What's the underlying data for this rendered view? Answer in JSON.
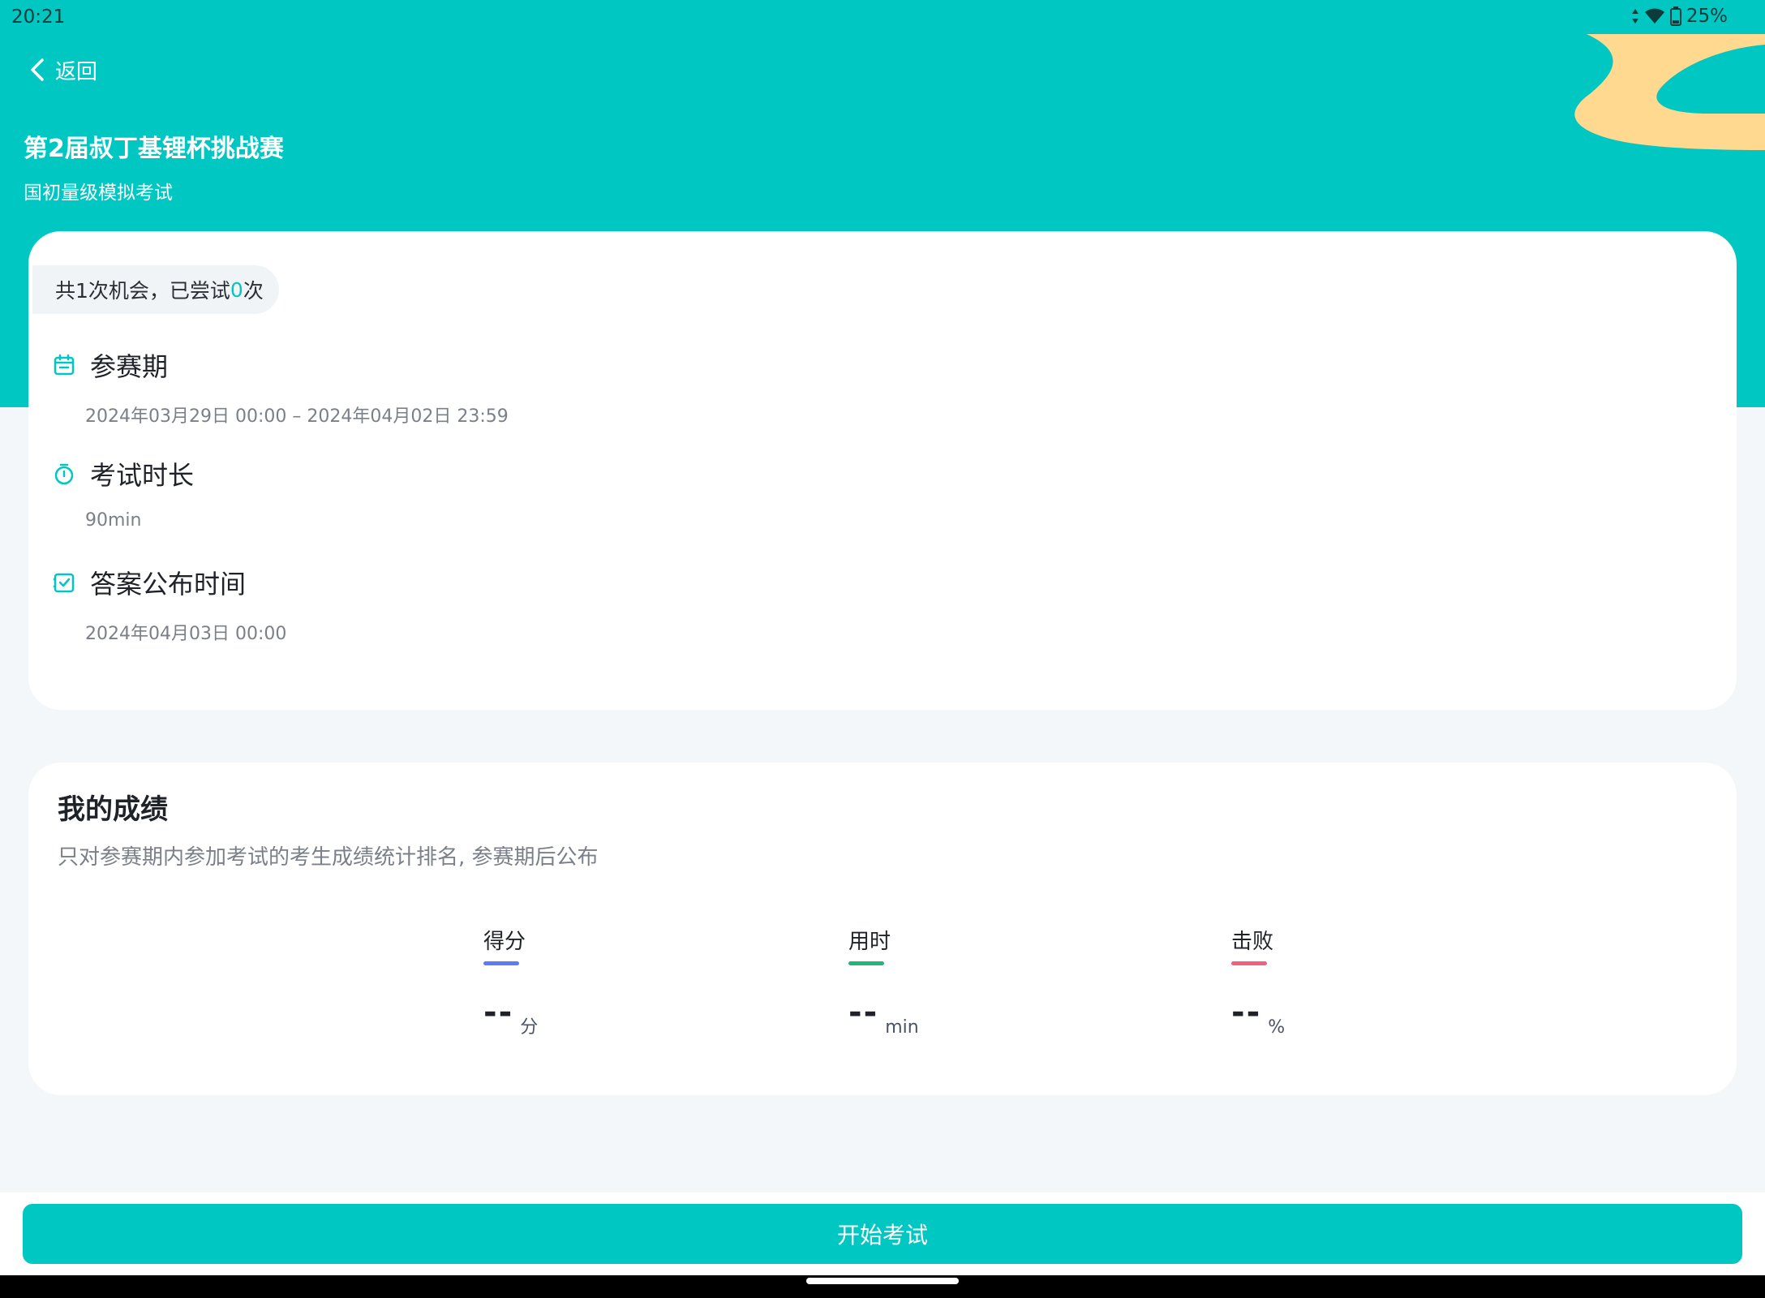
{
  "status_bar": {
    "time": "20:21",
    "battery": "25%"
  },
  "header": {
    "back_label": "返回",
    "title": "第2届叔丁基锂杯挑战赛",
    "subtitle": "国初量级模拟考试"
  },
  "info": {
    "attempts_prefix": "共1次机会，已尝试",
    "attempts_count": "0",
    "attempts_suffix": "次",
    "rows": [
      {
        "label": "参赛期",
        "value": "2024年03月29日 00:00  –  2024年04月02日 23:59",
        "icon": "calendar-icon"
      },
      {
        "label": "考试时长",
        "value": "90min",
        "icon": "stopwatch-icon"
      },
      {
        "label": "答案公布时间",
        "value": "2024年04月03日 00:00",
        "icon": "checklist-icon"
      }
    ]
  },
  "score": {
    "title": "我的成绩",
    "note": "只对参赛期内参加考试的考生成绩统计排名, 参赛期后公布",
    "stats": [
      {
        "label": "得分",
        "value": "--",
        "unit": "分",
        "color": "#5b7cf5"
      },
      {
        "label": "用时",
        "value": "--",
        "unit": "min",
        "color": "#1fb87a"
      },
      {
        "label": "击败",
        "value": "--",
        "unit": "%",
        "color": "#f0627f"
      }
    ]
  },
  "actions": {
    "start_label": "开始考试"
  },
  "colors": {
    "accent": "#00c7c1",
    "deco": "#ffd98f"
  }
}
